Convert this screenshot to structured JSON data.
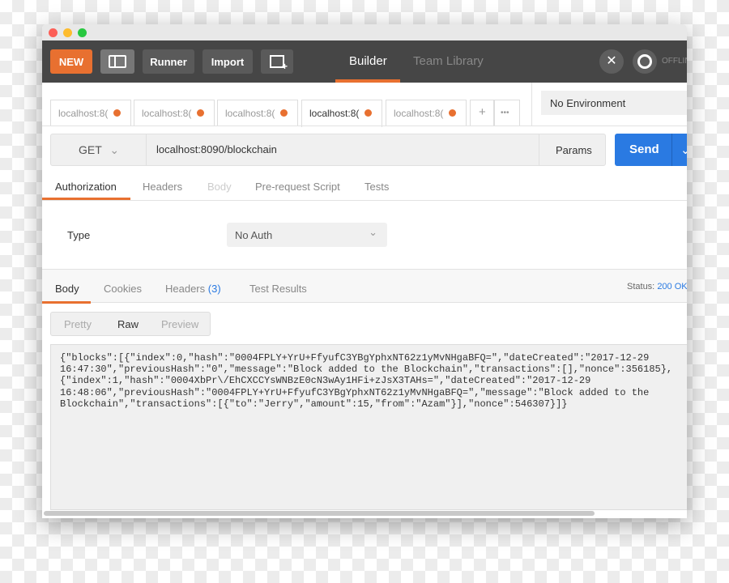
{
  "header": {
    "new": "NEW",
    "runner": "Runner",
    "import": "Import",
    "builder": "Builder",
    "team_library": "Team Library",
    "offline": "OFFLINE"
  },
  "tabs": [
    {
      "label": "localhost:8("
    },
    {
      "label": "localhost:8("
    },
    {
      "label": "localhost:8("
    },
    {
      "label": "localhost:8(",
      "active": true
    },
    {
      "label": "localhost:8("
    }
  ],
  "tab_add": "+",
  "tab_more": "•••",
  "environment": "No Environment",
  "request": {
    "method": "GET",
    "url": "localhost:8090/blockchain",
    "params": "Params",
    "send": "Send"
  },
  "req_tabs": [
    "Authorization",
    "Headers",
    "Body",
    "Pre-request Script",
    "Tests"
  ],
  "auth": {
    "type_label": "Type",
    "type_value": "No Auth"
  },
  "resp_tabs": {
    "body": "Body",
    "cookies": "Cookies",
    "headers": "Headers",
    "headers_count": "(3)",
    "tests": "Test Results"
  },
  "status": {
    "label": "Status:",
    "value": "200 OK"
  },
  "view_modes": [
    "Pretty",
    "Raw",
    "Preview"
  ],
  "response_body": "{\"blocks\":[{\"index\":0,\"hash\":\"0004FPLY+YrU+FfyufC3YBgYphxNT62z1yMvNHgaBFQ=\",\"dateCreated\":\"2017-12-29\n16:47:30\",\"previousHash\":\"0\",\"message\":\"Block added to the Blockchain\",\"transactions\":[],\"nonce\":356185},\n{\"index\":1,\"hash\":\"0004XbPr\\/EhCXCCYsWNBzE0cN3wAy1HFi+zJsX3TAHs=\",\"dateCreated\":\"2017-12-29\n16:48:06\",\"previousHash\":\"0004FPLY+YrU+FfyufC3YBgYphxNT62z1yMvNHgaBFQ=\",\"message\":\"Block added to the\nBlockchain\",\"transactions\":[{\"to\":\"Jerry\",\"amount\":15,\"from\":\"Azam\"}],\"nonce\":546307}]}",
  "colors": {
    "accent": "#e87030",
    "send": "#2a7ae2",
    "header": "#464646"
  }
}
